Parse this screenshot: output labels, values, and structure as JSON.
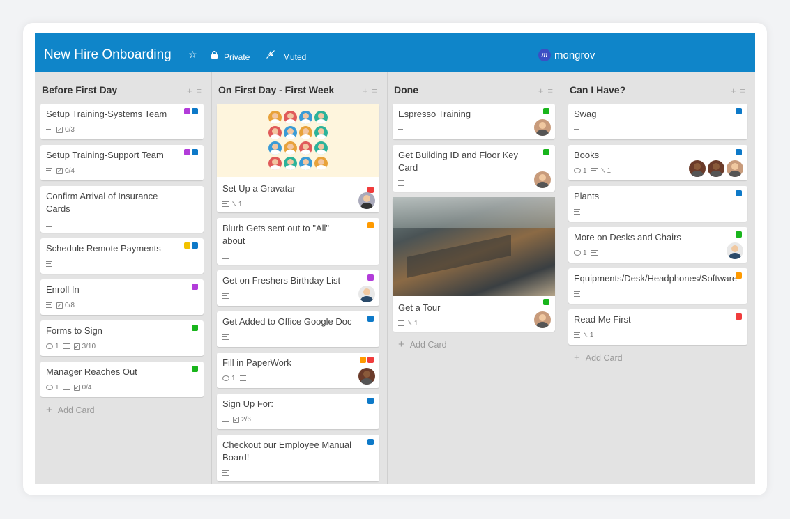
{
  "board": {
    "title": "New Hire Onboarding",
    "star_glyph": "☆",
    "privacy": "Private",
    "notifications": "Muted",
    "brand_mark": "m",
    "brand": "mongrov",
    "add_card_label": "Add Card"
  },
  "colors": {
    "header": "#0f85c9",
    "purple": "#b23cd9",
    "blue": "#0d79c8",
    "yellow": "#f2c200",
    "green": "#19b51c",
    "red": "#f03c3c",
    "orange": "#ff9a00"
  },
  "lists": [
    {
      "title": "Before First Day",
      "cards": [
        {
          "title": "Setup Training-Systems Team",
          "labels": [
            "purple",
            "blue"
          ],
          "checklist": "0/3"
        },
        {
          "title": "Setup Training-Support Team",
          "labels": [
            "purple",
            "blue"
          ],
          "checklist": "0/4"
        },
        {
          "title": "Confirm Arrival of Insurance Cards"
        },
        {
          "title": "Schedule Remote Payments",
          "labels": [
            "yellow",
            "blue"
          ]
        },
        {
          "title": "Enroll In",
          "labels": [
            "purple"
          ],
          "checklist": "0/8"
        },
        {
          "title": "Forms to Sign",
          "labels": [
            "green"
          ],
          "comments": "1",
          "checklist": "3/10"
        },
        {
          "title": "Manager Reaches Out",
          "labels": [
            "green"
          ],
          "comments": "1",
          "checklist": "0/4"
        }
      ]
    },
    {
      "title": "On First Day - First Week",
      "cards": [
        {
          "title": "Set Up a Gravatar",
          "labels": [
            "red"
          ],
          "attachments": "1",
          "cover": "people"
        },
        {
          "title": "Blurb Gets sent out to \"All\" about",
          "labels": [
            "orange"
          ]
        },
        {
          "title": "Get on Freshers Birthday List",
          "labels": [
            "purple"
          ]
        },
        {
          "title": "Get Added to Office Google Doc",
          "labels": [
            "blue"
          ]
        },
        {
          "title": "Fill in PaperWork",
          "labels": [
            "orange",
            "red"
          ],
          "comments": "1"
        },
        {
          "title": "Sign Up For:",
          "labels": [
            "blue"
          ],
          "checklist": "2/6"
        },
        {
          "title": "Checkout our Employee Manual Board!",
          "labels": [
            "blue"
          ]
        }
      ]
    },
    {
      "title": "Done",
      "cards": [
        {
          "title": "Espresso Training",
          "labels": [
            "green"
          ]
        },
        {
          "title": "Get Building ID and Floor Key Card",
          "labels": [
            "green"
          ]
        },
        {
          "title": "Get a Tour",
          "labels": [
            "green"
          ],
          "attachments": "1",
          "cover": "photo"
        }
      ]
    },
    {
      "title": "Can I Have?",
      "cards": [
        {
          "title": "Swag",
          "labels": [
            "blue"
          ]
        },
        {
          "title": "Books",
          "labels": [
            "blue"
          ],
          "comments": "1",
          "attachments": "1"
        },
        {
          "title": "Plants",
          "labels": [
            "blue"
          ]
        },
        {
          "title": "More on Desks and Chairs",
          "labels": [
            "green"
          ],
          "comments": "1"
        },
        {
          "title": "Equipments/Desk/Headphones/Software",
          "labels": [
            "orange"
          ]
        },
        {
          "title": "Read Me First",
          "labels": [
            "red"
          ],
          "attachments": "1"
        }
      ]
    }
  ]
}
